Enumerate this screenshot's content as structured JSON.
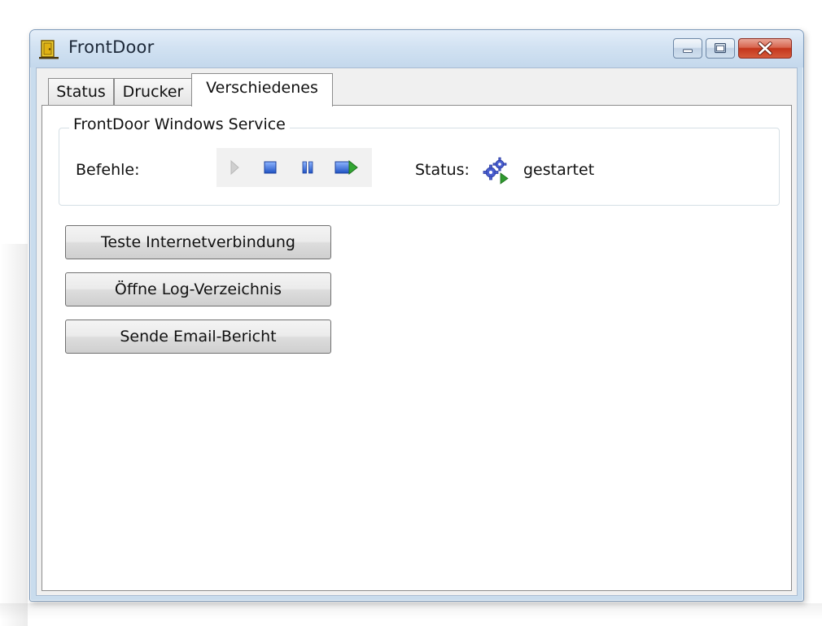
{
  "window": {
    "title": "FrontDoor",
    "icon": "door-icon",
    "caption_buttons": [
      "minimize-icon",
      "maximize-icon",
      "close-icon"
    ]
  },
  "tabs": [
    {
      "label": "Status",
      "selected": false
    },
    {
      "label": "Drucker",
      "selected": false
    },
    {
      "label": "Verschiedenes",
      "selected": true
    }
  ],
  "service_group": {
    "title": "FrontDoor Windows Service",
    "commands_label": "Befehle:",
    "commands": [
      {
        "name": "start",
        "icon": "play-icon",
        "enabled": false
      },
      {
        "name": "stop",
        "icon": "stop-icon",
        "enabled": true
      },
      {
        "name": "pause",
        "icon": "pause-icon",
        "enabled": true
      },
      {
        "name": "restart",
        "icon": "restart-icon",
        "enabled": true
      }
    ],
    "status_label": "Status:",
    "status_icon": "running-gears-icon",
    "status_value": "gestartet"
  },
  "actions": {
    "test_internet": "Teste Internetverbindung",
    "open_log": "Öffne Log-Verzeichnis",
    "send_email": "Sende Email-Bericht"
  },
  "colors": {
    "frame": "#c9dced",
    "close_button": "#c4361c",
    "command_blue": "#2b63d6",
    "status_gears": "#4a5fd0",
    "status_play": "#2f9a2f"
  }
}
